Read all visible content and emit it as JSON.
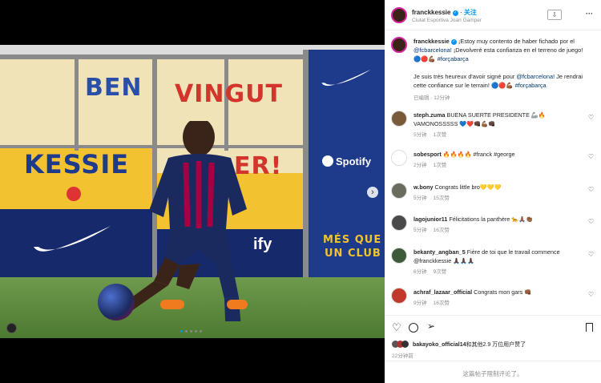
{
  "post": {
    "username": "franckkessie",
    "follow_label": "关注",
    "location": "Ciutat Esportiva Joan Gamper",
    "more_label": "···"
  },
  "photo": {
    "board_words": [
      "BEN",
      "VINGUT",
      "KESSIE",
      "ER!",
      "MÉS QUE",
      "UN CLUB"
    ],
    "brand_spotify": "Spotify",
    "brand_ify": "ify",
    "slide_count": 5,
    "active_slide": 0
  },
  "caption": {
    "username": "franckkessie",
    "text1": "¡Estoy muy contento de haber fichado por el",
    "mention1": "@fcbarcelona!",
    "text2": "¡Devolveré esta confianza en el terreno de juego!",
    "emojis1": "🔵🔴💪🏾",
    "hashtag1": "#forçabarça",
    "text3": "Je suis très heureux d'avoir signé pour",
    "mention2": "@fcbarcelona!",
    "text4": "Je rendrai cette confiance sur le terrain!",
    "emojis2": "🔵🔴💪🏾",
    "hashtag2": "#forçabarça",
    "time": "已编辑 · 12分钟"
  },
  "comments": [
    {
      "user": "steph.zuma",
      "text": "BUENA SUERTE PRESIDENTE 🦾🔥 VAMONOSSSSS 💙❤️👊🏿💪🏾👊🏿",
      "time": "5分钟",
      "likes": "1次赞",
      "color": "#7b5a3a"
    },
    {
      "user": "sobesport",
      "text": "🔥🔥🔥🔥 #franck #george",
      "time": "2分钟",
      "likes": "1次赞",
      "color": "#ffffff"
    },
    {
      "user": "w.bony",
      "text": "Congrats little bro💛💛💛",
      "time": "5分钟",
      "likes": "15次赞",
      "color": "#6b6b5e"
    },
    {
      "user": "lagojunior11",
      "text": "Félicitations la panthère 🐆🙏🏾👏🏾",
      "time": "5分钟",
      "likes": "16次赞",
      "color": "#4a4a4a"
    },
    {
      "user": "bekanty_angban_5",
      "text": "Fière de toi que le travail commence @franckkessie 🙏🏿🙏🏿🙏🏿",
      "time": "6分钟",
      "likes": "9次赞",
      "color": "#3d5a3a"
    },
    {
      "user": "achraf_lazaar_official",
      "text": "Congrats mon gars 👊🏾",
      "time": "9分钟",
      "likes": "16次赞",
      "color": "#c0392b"
    }
  ],
  "likes_line": {
    "user": "bakayoko_official14",
    "text": "和其他2.9 万位用户赞了"
  },
  "post_time": "22分钟前",
  "footer_text": "这篇帖子限制评论了。",
  "colors": {
    "accent": "#0095f6",
    "barca_blue": "#1e3a8a",
    "barca_red": "#a50044"
  }
}
